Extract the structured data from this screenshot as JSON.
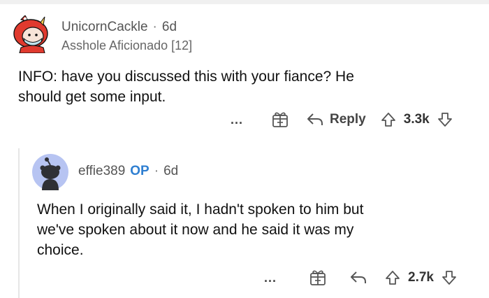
{
  "comments": [
    {
      "username": "UnicornCackle",
      "age": "6d",
      "flair": "Asshole Aficionado [12]",
      "body_lines": [
        "INFO: have you discussed this with your fiance? He",
        "should get some input."
      ],
      "actions": {
        "more": "...",
        "reply_label": "Reply",
        "votes": "3.3k"
      }
    },
    {
      "username": "effie389",
      "op_badge": "OP",
      "age": "6d",
      "body_lines": [
        "When I originally said it, I hadn't spoken to him but",
        "we've spoken about it now and he said it was my",
        "choice."
      ],
      "actions": {
        "more": "...",
        "votes": "2.7k"
      }
    }
  ],
  "separator": "·",
  "colors": {
    "op": "#2f7fd1",
    "avatar_red": "#e03a2e",
    "snoo_bg": "#b7c4f2"
  },
  "icons": [
    "avatar-unicorn",
    "avatar-snoo",
    "more-icon",
    "award-icon",
    "reply-icon",
    "upvote-icon",
    "downvote-icon"
  ]
}
